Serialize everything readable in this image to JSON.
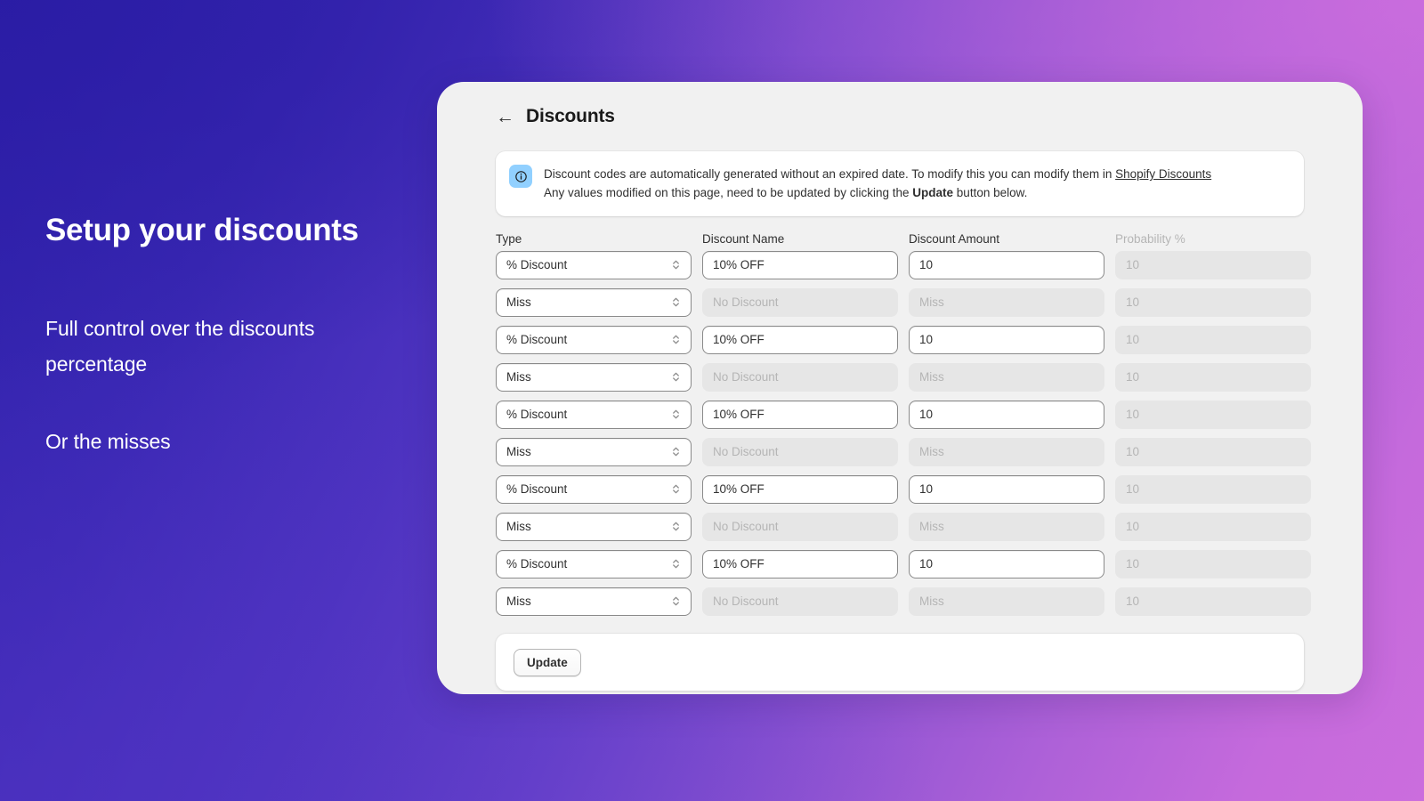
{
  "promo": {
    "title": "Setup your discounts",
    "line1": "Full control over the discounts percentage",
    "line2": "Or the misses"
  },
  "header": {
    "back_icon": "←",
    "title": "Discounts"
  },
  "banner": {
    "icon": "info-icon",
    "text_before_link": "Discount codes are automatically generated without an expired date. To modify this you can modify them in ",
    "link_text": "Shopify Discounts",
    "line2_before": "Any values modified on this page, need to be updated by clicking the ",
    "line2_strong": "Update",
    "line2_after": " button below."
  },
  "table": {
    "headers": {
      "type": "Type",
      "discount_name": "Discount Name",
      "discount_amount": "Discount Amount",
      "probability": "Probability %"
    },
    "rows": [
      {
        "type": "% Discount",
        "name": "10% OFF",
        "amount": "10",
        "probability": "10",
        "enabled": true
      },
      {
        "type": "Miss",
        "name": "No Discount",
        "amount": "Miss",
        "probability": "10",
        "enabled": false
      },
      {
        "type": "% Discount",
        "name": "10% OFF",
        "amount": "10",
        "probability": "10",
        "enabled": true
      },
      {
        "type": "Miss",
        "name": "No Discount",
        "amount": "Miss",
        "probability": "10",
        "enabled": false
      },
      {
        "type": "% Discount",
        "name": "10% OFF",
        "amount": "10",
        "probability": "10",
        "enabled": true
      },
      {
        "type": "Miss",
        "name": "No Discount",
        "amount": "Miss",
        "probability": "10",
        "enabled": false
      },
      {
        "type": "% Discount",
        "name": "10% OFF",
        "amount": "10",
        "probability": "10",
        "enabled": true
      },
      {
        "type": "Miss",
        "name": "No Discount",
        "amount": "Miss",
        "probability": "10",
        "enabled": false
      },
      {
        "type": "% Discount",
        "name": "10% OFF",
        "amount": "10",
        "probability": "10",
        "enabled": true
      },
      {
        "type": "Miss",
        "name": "No Discount",
        "amount": "Miss",
        "probability": "10",
        "enabled": false
      }
    ]
  },
  "footer": {
    "update_label": "Update"
  },
  "colors": {
    "gradient_start": "#3022ac",
    "gradient_end": "#c66bdc",
    "card_bg": "#f1f1f1",
    "info_icon_bg": "#91d0ff",
    "disabled_field_bg": "#e6e6e6",
    "disabled_text": "#b5b5b5",
    "text": "#303030"
  }
}
